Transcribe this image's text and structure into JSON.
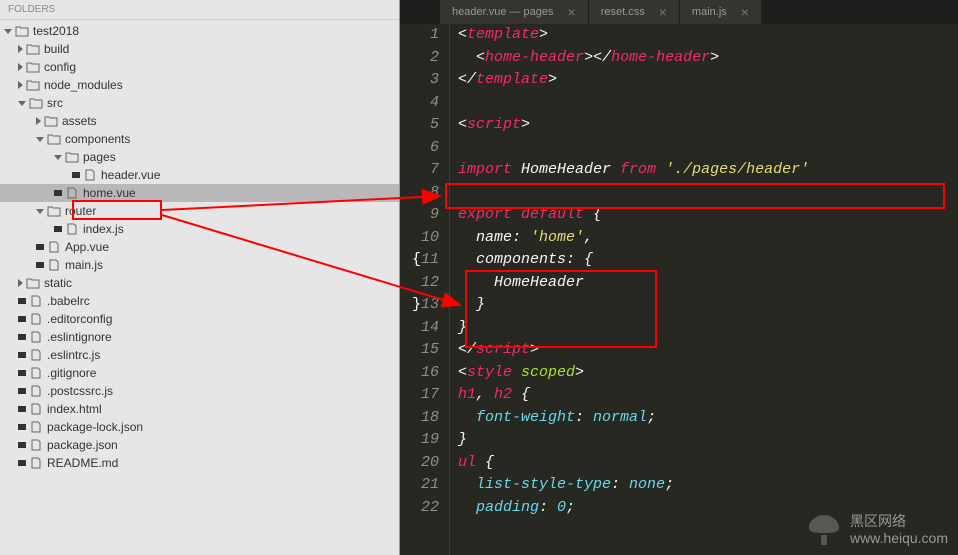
{
  "sidebar": {
    "header": "FOLDERS",
    "tree": {
      "root": "test2018",
      "build": "build",
      "config": "config",
      "node_modules": "node_modules",
      "src": "src",
      "assets": "assets",
      "components": "components",
      "pages": "pages",
      "header_vue": "header.vue",
      "home_vue": "home.vue",
      "router": "router",
      "index_js": "index.js",
      "app_vue": "App.vue",
      "main_js": "main.js",
      "static": "static",
      "babelrc": ".babelrc",
      "editorconfig": ".editorconfig",
      "eslintignore": ".eslintignore",
      "eslintrc": ".eslintrc.js",
      "gitignore": ".gitignore",
      "postcssrc": ".postcssrc.js",
      "index_html": "index.html",
      "package_lock": "package-lock.json",
      "package_json": "package.json",
      "readme": "README.md"
    }
  },
  "tabs": {
    "t1": "header.vue — pages",
    "t2": "reset.css",
    "t3": "main.js"
  },
  "code": {
    "l1_open": "<",
    "l1_tag": "template",
    "l1_close": ">",
    "l2_open": "<",
    "l2_tag": "home-header",
    "l2_mid": "></",
    "l2_close": ">",
    "l3_open": "</",
    "l3_tag": "template",
    "l3_close": ">",
    "l5_open": "<",
    "l5_tag": "script",
    "l5_close": ">",
    "l7_import": "import",
    "l7_name": " HomeHeader ",
    "l7_from": "from",
    "l7_str": " './pages/header'",
    "l9_export": "export",
    "l9_default": "default",
    "l9_brace": " {",
    "l10_name": "  name",
    "l10_colon": ": ",
    "l10_str": "'home'",
    "l10_comma": ",",
    "l11_comp": "  components",
    "l11_colon": ": {",
    "l12_home": "    HomeHeader",
    "l13_brace": "  }",
    "l14_brace": "}",
    "l15_open": "</",
    "l15_tag": "script",
    "l15_close": ">",
    "l16_open": "<",
    "l16_tag": "style",
    "l16_attr": " scoped",
    "l16_close": ">",
    "l17_sel": "h1",
    "l17_comma": ", ",
    "l17_sel2": "h2",
    "l17_brace": " {",
    "l18_prop": "  font-weight",
    "l18_colon": ": ",
    "l18_val": "normal",
    "l18_semi": ";",
    "l19_brace": "}",
    "l20_sel": "ul",
    "l20_brace": " {",
    "l21_prop": "  list-style-type",
    "l21_colon": ": ",
    "l21_val": "none",
    "l21_semi": ";",
    "l22_prop": "  padding",
    "l22_colon": ": ",
    "l22_val": "0",
    "l22_semi": ";"
  },
  "gutter": {
    "n1": "1",
    "n2": "2",
    "n3": "3",
    "n4": "4",
    "n5": "5",
    "n6": "6",
    "n7": "7",
    "n8": "8",
    "n9": "9",
    "n10": "10",
    "n11": "11",
    "n12": "12",
    "n13": "13",
    "n14": "14",
    "n15": "15",
    "n16": "16",
    "n17": "17",
    "n18": "18",
    "n19": "19",
    "n20": "20",
    "n21": "21",
    "n22": "22"
  },
  "watermark": {
    "line1": "黑区网络",
    "line2": "www.heiqu.com"
  }
}
